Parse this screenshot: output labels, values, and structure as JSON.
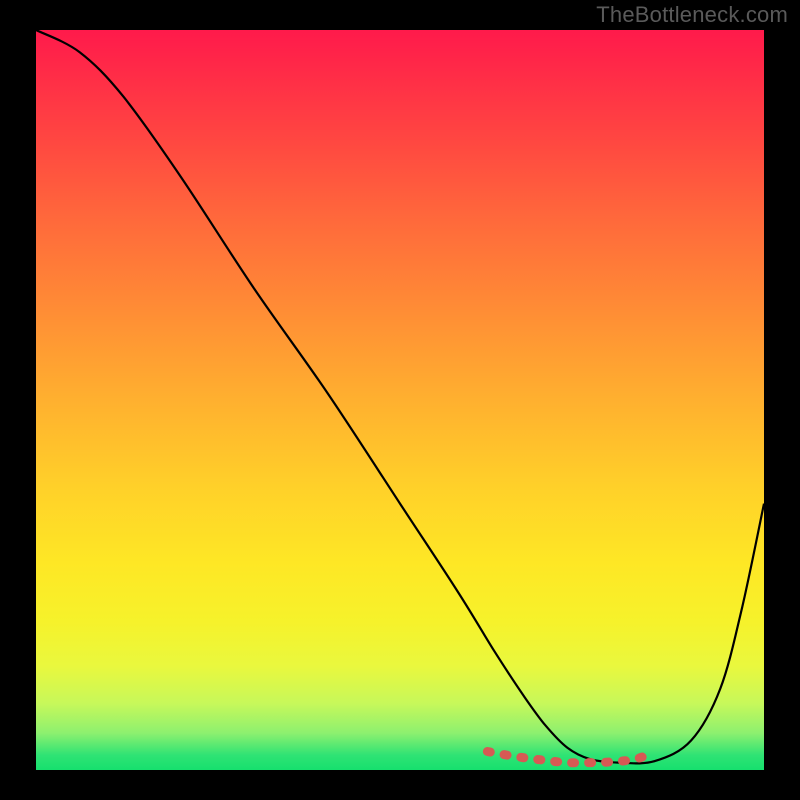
{
  "watermark": "TheBottleneck.com",
  "colors": {
    "background": "#000000",
    "curve": "#000000",
    "marker": "#d65a54",
    "gradient_top": "#ff1a4b",
    "gradient_bottom": "#16e06e"
  },
  "chart_data": {
    "type": "line",
    "title": "",
    "xlabel": "",
    "ylabel": "",
    "xlim": [
      0,
      100
    ],
    "ylim": [
      0,
      100
    ],
    "grid": false,
    "legend": false,
    "series": [
      {
        "name": "bottleneck-curve",
        "x": [
          0,
          6,
          12,
          20,
          30,
          40,
          50,
          58,
          63,
          67,
          70,
          73,
          76,
          80,
          85,
          90,
          94,
          97,
          100
        ],
        "y": [
          100,
          97,
          91,
          80,
          65,
          51,
          36,
          24,
          16,
          10,
          6,
          3,
          1.5,
          1,
          1.2,
          4,
          11,
          22,
          36
        ]
      }
    ],
    "marker_region": {
      "name": "optimal-zone",
      "x": [
        62,
        66,
        70,
        73,
        76,
        79,
        82,
        84
      ],
      "y": [
        2.5,
        1.8,
        1.3,
        1.0,
        1.0,
        1.1,
        1.4,
        2.0
      ]
    }
  }
}
